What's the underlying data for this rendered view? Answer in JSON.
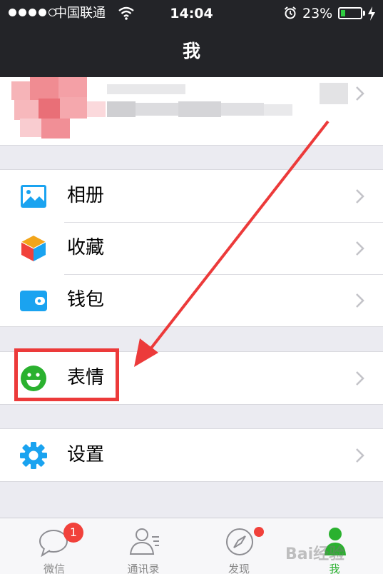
{
  "status_bar": {
    "carrier": "中国联通",
    "time": "14:04",
    "battery_percent": "23%",
    "battery_level": 0.23
  },
  "nav": {
    "title": "我"
  },
  "menu": {
    "group1": [
      {
        "label": "相册",
        "icon": "photo-album-icon",
        "color": "#1aa3f0"
      },
      {
        "label": "收藏",
        "icon": "favorites-cube-icon",
        "color": "#f2a51a"
      },
      {
        "label": "钱包",
        "icon": "wallet-icon",
        "color": "#1aa3f0"
      }
    ],
    "group2": [
      {
        "label": "表情",
        "icon": "emoji-smiley-icon",
        "color": "#2ab12f"
      }
    ],
    "group3": [
      {
        "label": "设置",
        "icon": "gear-icon",
        "color": "#1aa3f0"
      }
    ]
  },
  "tabbar": {
    "tabs": [
      {
        "label": "微信",
        "badge": "1"
      },
      {
        "label": "通讯录"
      },
      {
        "label": "发现"
      },
      {
        "label": "我"
      }
    ],
    "active_color": "#2ab12f"
  },
  "watermark": "Bai经验"
}
